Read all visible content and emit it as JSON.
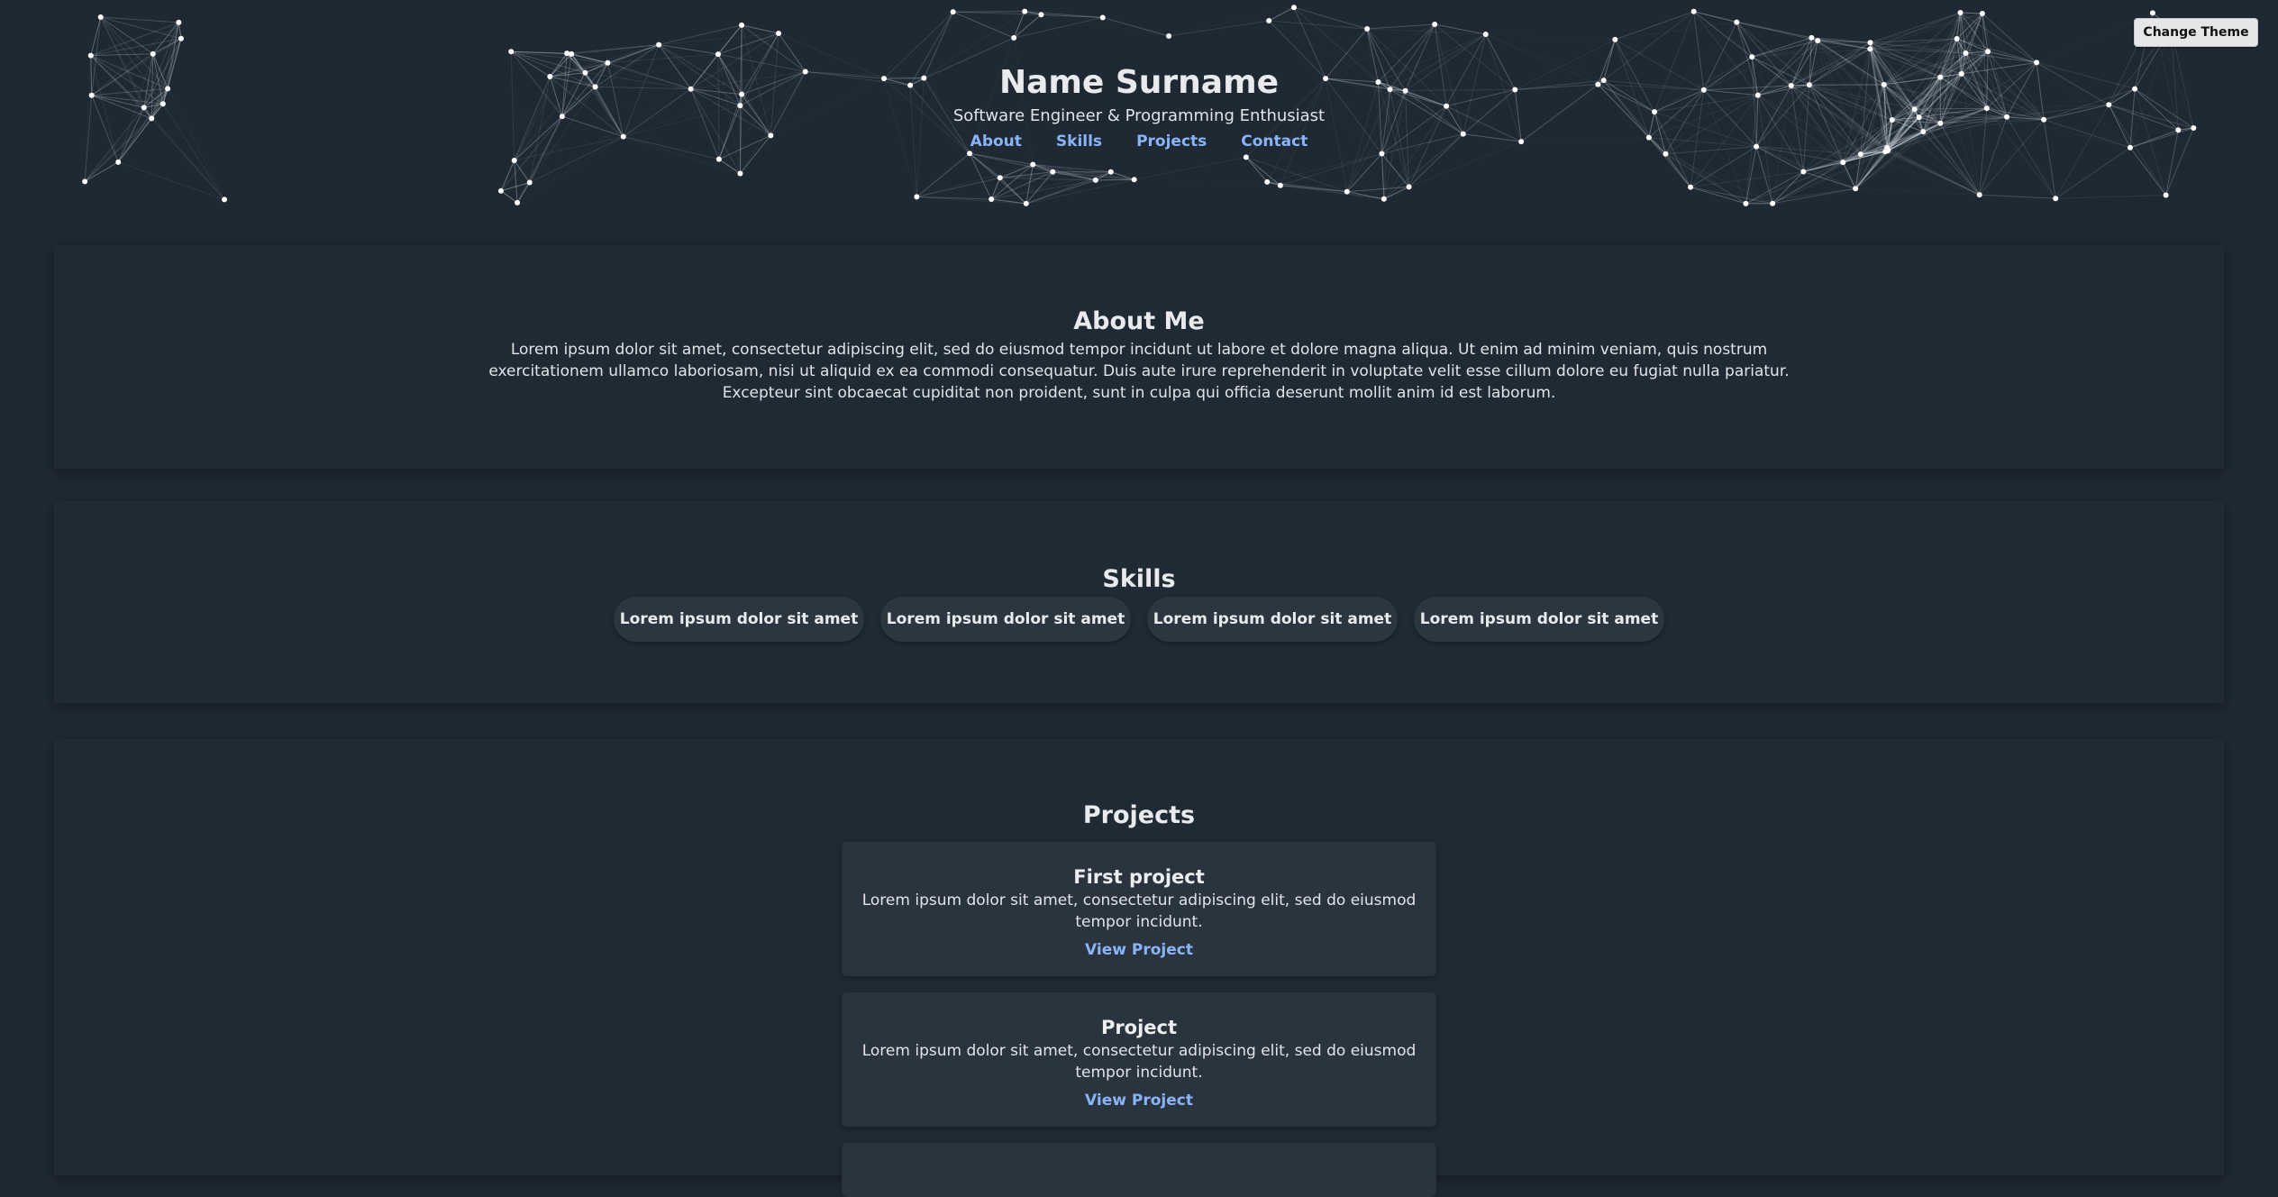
{
  "header": {
    "name": "Name Surname",
    "subtitle": "Software Engineer & Programming Enthusiast",
    "nav": [
      {
        "label": "About"
      },
      {
        "label": "Skills"
      },
      {
        "label": "Projects"
      },
      {
        "label": "Contact"
      }
    ],
    "theme_button": "Change Theme"
  },
  "about": {
    "title": "About Me",
    "text": "Lorem ipsum dolor sit amet, consectetur adipiscing elit, sed do eiusmod tempor incidunt ut labore et dolore magna aliqua. Ut enim ad minim veniam, quis nostrum exercitationem ullamco laboriosam, nisi ut aliquid ex ea commodi consequatur. Duis aute irure reprehenderit in voluptate velit esse cillum dolore eu fugiat nulla pariatur. Excepteur sint obcaecat cupiditat non proident, sunt in culpa qui officia deserunt mollit anim id est laborum."
  },
  "skills": {
    "title": "Skills",
    "items": [
      "Lorem ipsum dolor sit amet",
      "Lorem ipsum dolor sit amet",
      "Lorem ipsum dolor sit amet",
      "Lorem ipsum dolor sit amet"
    ]
  },
  "projects": {
    "title": "Projects",
    "items": [
      {
        "title": "First project",
        "description": "Lorem ipsum dolor sit amet, consectetur adipiscing elit, sed do eiusmod tempor incidunt.",
        "link": "View Project"
      },
      {
        "title": "Project",
        "description": "Lorem ipsum dolor sit amet, consectetur adipiscing elit, sed do eiusmod tempor incidunt.",
        "link": "View Project"
      },
      {
        "title": "",
        "description": "",
        "link": ""
      }
    ]
  },
  "colors": {
    "background": "#1f2933",
    "panel": "#1f2a34",
    "card": "#2a343e",
    "link": "#8ab4f8",
    "network_node": "#ffffff"
  }
}
